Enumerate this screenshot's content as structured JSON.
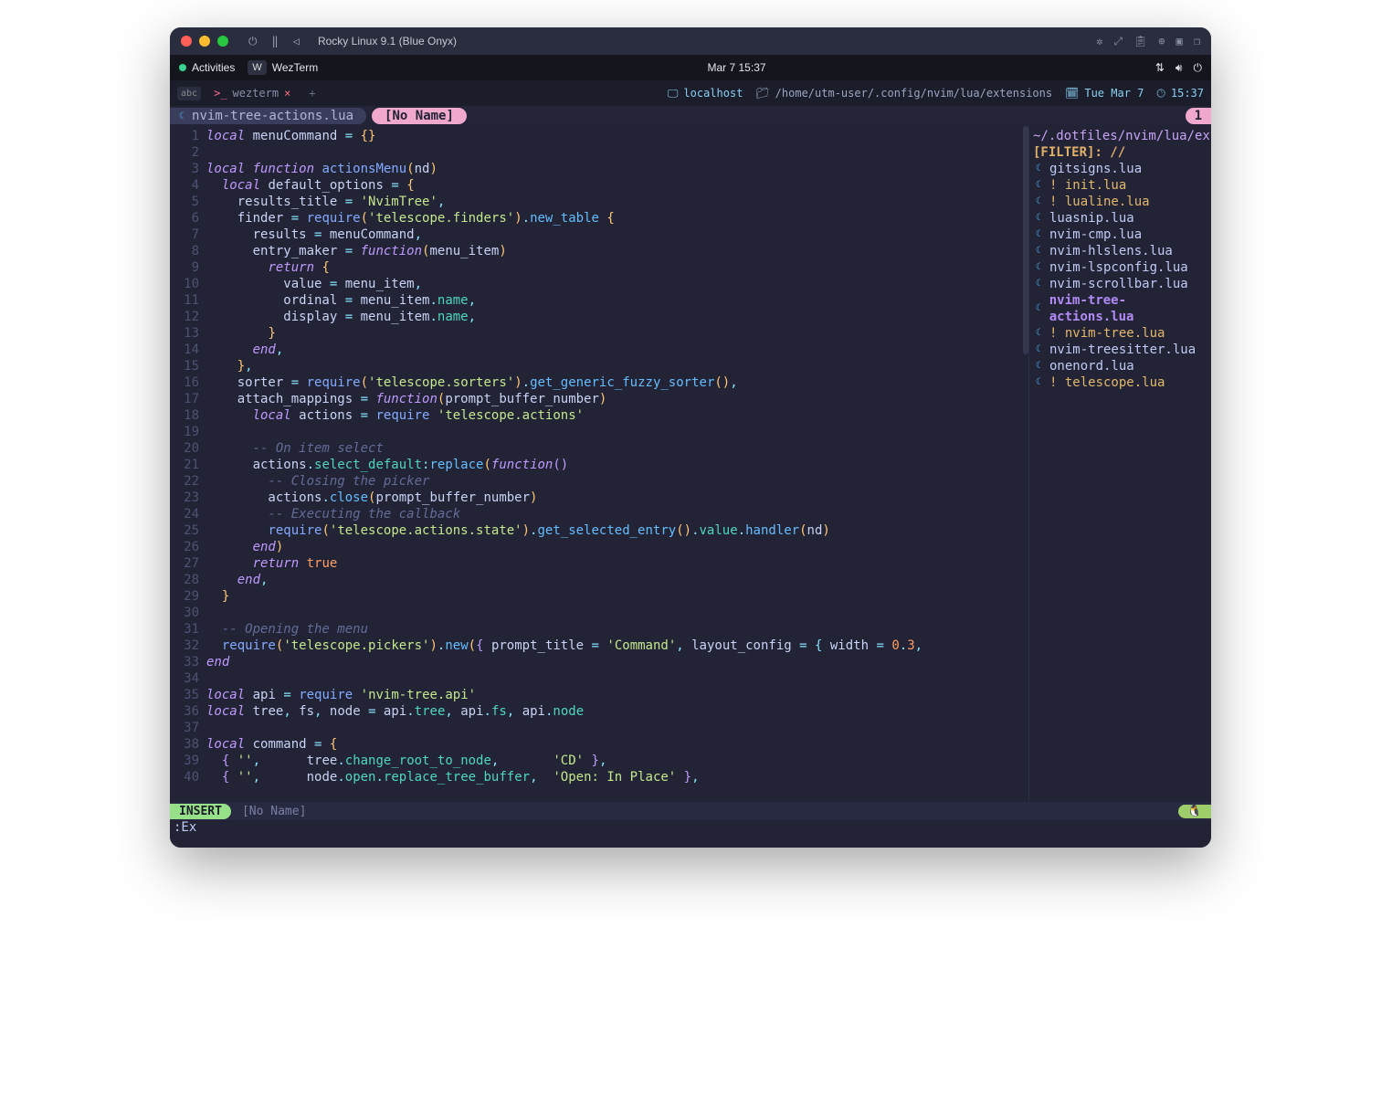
{
  "mac_titlebar": {
    "title": "Rocky Linux 9.1 (Blue Onyx)"
  },
  "gnome": {
    "activities": "Activities",
    "app_name": "WezTerm",
    "clock": "Mar 7  15:37"
  },
  "term_tabs": {
    "abc_badge": "abc",
    "tab_label": "wezterm",
    "host": "localhost",
    "path": "/home/utm-user/.config/nvim/lua/extensions",
    "date": "Tue Mar 7",
    "time": "15:37"
  },
  "bufferline": {
    "tab1": "nvim-tree-actions.lua",
    "tab2": "[No Name]",
    "count": "1"
  },
  "sidebar": {
    "path": "~/.dotfiles/nvim/lua/exte",
    "filter_label": "[FILT",
    "filter_typed": "E",
    "filter_after": "R]: //",
    "files": [
      {
        "name": "gitsigns.lua",
        "mod": false
      },
      {
        "name": "! init.lua",
        "mod": true
      },
      {
        "name": "! lualine.lua",
        "mod": true
      },
      {
        "name": "luasnip.lua",
        "mod": false
      },
      {
        "name": "nvim-cmp.lua",
        "mod": false
      },
      {
        "name": "nvim-hlslens.lua",
        "mod": false
      },
      {
        "name": "nvim-lspconfig.lua",
        "mod": false
      },
      {
        "name": "nvim-scrollbar.lua",
        "mod": false
      },
      {
        "name": "nvim-tree-actions.lua",
        "mod": false,
        "sel": true
      },
      {
        "name": "! nvim-tree.lua",
        "mod": true
      },
      {
        "name": "nvim-treesitter.lua",
        "mod": false
      },
      {
        "name": "onenord.lua",
        "mod": false
      },
      {
        "name": "! telescope.lua",
        "mod": true
      }
    ]
  },
  "statusline": {
    "mode": "INSERT",
    "filename": "[No Name]",
    "os_icon": "🐧"
  },
  "cmdline": ":Ex",
  "code_lines": [
    {
      "n": 1,
      "tokens": [
        [
          "kw",
          "local"
        ],
        [
          "id",
          " menuCommand "
        ],
        [
          "op",
          "="
        ],
        [
          "id",
          " "
        ],
        [
          "par",
          "{}"
        ]
      ]
    },
    {
      "n": 2,
      "tokens": []
    },
    {
      "n": 3,
      "tokens": [
        [
          "kw",
          "local function"
        ],
        [
          "id",
          " "
        ],
        [
          "fn",
          "actionsMenu"
        ],
        [
          "par",
          "("
        ],
        [
          "id",
          "nd"
        ],
        [
          "par",
          ")"
        ]
      ]
    },
    {
      "n": 4,
      "tokens": [
        [
          "id",
          "  "
        ],
        [
          "kw",
          "local"
        ],
        [
          "id",
          " default_options "
        ],
        [
          "op",
          "="
        ],
        [
          "id",
          " "
        ],
        [
          "par",
          "{"
        ]
      ]
    },
    {
      "n": 5,
      "tokens": [
        [
          "id",
          "    results_title "
        ],
        [
          "op",
          "="
        ],
        [
          "id",
          " "
        ],
        [
          "str",
          "'NvimTree'"
        ],
        [
          "op",
          ","
        ]
      ]
    },
    {
      "n": 6,
      "tokens": [
        [
          "id",
          "    finder "
        ],
        [
          "op",
          "="
        ],
        [
          "id",
          " "
        ],
        [
          "fn",
          "require"
        ],
        [
          "par",
          "("
        ],
        [
          "str",
          "'telescope.finders'"
        ],
        [
          "par",
          ")"
        ],
        [
          "op",
          "."
        ],
        [
          "fnb",
          "new_table"
        ],
        [
          "id",
          " "
        ],
        [
          "par",
          "{"
        ]
      ]
    },
    {
      "n": 7,
      "tokens": [
        [
          "id",
          "      results "
        ],
        [
          "op",
          "="
        ],
        [
          "id",
          " menuCommand"
        ],
        [
          "op",
          ","
        ]
      ]
    },
    {
      "n": 8,
      "tokens": [
        [
          "id",
          "      entry_maker "
        ],
        [
          "op",
          "="
        ],
        [
          "id",
          " "
        ],
        [
          "kw",
          "function"
        ],
        [
          "par",
          "("
        ],
        [
          "id",
          "menu_item"
        ],
        [
          "par",
          ")"
        ]
      ]
    },
    {
      "n": 9,
      "tokens": [
        [
          "id",
          "        "
        ],
        [
          "kw",
          "return"
        ],
        [
          "id",
          " "
        ],
        [
          "par",
          "{"
        ]
      ]
    },
    {
      "n": 10,
      "tokens": [
        [
          "id",
          "          value "
        ],
        [
          "op",
          "="
        ],
        [
          "id",
          " menu_item"
        ],
        [
          "op",
          ","
        ]
      ]
    },
    {
      "n": 11,
      "tokens": [
        [
          "id",
          "          ordinal "
        ],
        [
          "op",
          "="
        ],
        [
          "id",
          " menu_item"
        ],
        [
          "op",
          "."
        ],
        [
          "prop",
          "name"
        ],
        [
          "op",
          ","
        ]
      ]
    },
    {
      "n": 12,
      "tokens": [
        [
          "id",
          "          display "
        ],
        [
          "op",
          "="
        ],
        [
          "id",
          " menu_item"
        ],
        [
          "op",
          "."
        ],
        [
          "prop",
          "name"
        ],
        [
          "op",
          ","
        ]
      ]
    },
    {
      "n": 13,
      "tokens": [
        [
          "id",
          "        "
        ],
        [
          "par",
          "}"
        ]
      ]
    },
    {
      "n": 14,
      "tokens": [
        [
          "id",
          "      "
        ],
        [
          "kw",
          "end"
        ],
        [
          "op",
          ","
        ]
      ]
    },
    {
      "n": 15,
      "tokens": [
        [
          "id",
          "    "
        ],
        [
          "par",
          "}"
        ],
        [
          "op",
          ","
        ]
      ]
    },
    {
      "n": 16,
      "tokens": [
        [
          "id",
          "    sorter "
        ],
        [
          "op",
          "="
        ],
        [
          "id",
          " "
        ],
        [
          "fn",
          "require"
        ],
        [
          "par",
          "("
        ],
        [
          "str",
          "'telescope.sorters'"
        ],
        [
          "par",
          ")"
        ],
        [
          "op",
          "."
        ],
        [
          "fnb",
          "get_generic_fuzzy_sorter"
        ],
        [
          "par",
          "()"
        ],
        [
          "op",
          ","
        ]
      ]
    },
    {
      "n": 17,
      "tokens": [
        [
          "id",
          "    attach_mappings "
        ],
        [
          "op",
          "="
        ],
        [
          "id",
          " "
        ],
        [
          "kw",
          "function"
        ],
        [
          "par",
          "("
        ],
        [
          "id",
          "prompt_buffer_number"
        ],
        [
          "par",
          ")"
        ]
      ]
    },
    {
      "n": 18,
      "tokens": [
        [
          "id",
          "      "
        ],
        [
          "kw",
          "local"
        ],
        [
          "id",
          " actions "
        ],
        [
          "op",
          "="
        ],
        [
          "id",
          " "
        ],
        [
          "fn",
          "require"
        ],
        [
          "id",
          " "
        ],
        [
          "str",
          "'telescope.actions'"
        ]
      ]
    },
    {
      "n": 19,
      "tokens": []
    },
    {
      "n": 20,
      "tokens": [
        [
          "id",
          "      "
        ],
        [
          "comment",
          "-- On item select"
        ]
      ]
    },
    {
      "n": 21,
      "tokens": [
        [
          "id",
          "      actions"
        ],
        [
          "op",
          "."
        ],
        [
          "prop",
          "select_default"
        ],
        [
          "op",
          ":"
        ],
        [
          "fnb",
          "replace"
        ],
        [
          "par",
          "("
        ],
        [
          "kw",
          "function"
        ],
        [
          "par2",
          "()"
        ]
      ]
    },
    {
      "n": 22,
      "tokens": [
        [
          "id",
          "        "
        ],
        [
          "comment",
          "-- Closing the picker"
        ]
      ]
    },
    {
      "n": 23,
      "tokens": [
        [
          "id",
          "        actions"
        ],
        [
          "op",
          "."
        ],
        [
          "fnb",
          "close"
        ],
        [
          "par",
          "("
        ],
        [
          "id",
          "prompt_buffer_number"
        ],
        [
          "par",
          ")"
        ]
      ]
    },
    {
      "n": 24,
      "tokens": [
        [
          "id",
          "        "
        ],
        [
          "comment",
          "-- Executing the callback"
        ]
      ]
    },
    {
      "n": 25,
      "tokens": [
        [
          "id",
          "        "
        ],
        [
          "fn",
          "require"
        ],
        [
          "par",
          "("
        ],
        [
          "str",
          "'telescope.actions.state'"
        ],
        [
          "par",
          ")"
        ],
        [
          "op",
          "."
        ],
        [
          "fnb",
          "get_selected_entry"
        ],
        [
          "par",
          "()"
        ],
        [
          "op",
          "."
        ],
        [
          "prop",
          "value"
        ],
        [
          "op",
          "."
        ],
        [
          "fnb",
          "handler"
        ],
        [
          "par",
          "("
        ],
        [
          "id",
          "nd"
        ],
        [
          "par",
          ")"
        ]
      ]
    },
    {
      "n": 26,
      "tokens": [
        [
          "id",
          "      "
        ],
        [
          "kw",
          "end"
        ],
        [
          "par",
          ")"
        ]
      ]
    },
    {
      "n": 27,
      "tokens": [
        [
          "id",
          "      "
        ],
        [
          "kw",
          "return"
        ],
        [
          "id",
          " "
        ],
        [
          "bool",
          "true"
        ]
      ]
    },
    {
      "n": 28,
      "tokens": [
        [
          "id",
          "    "
        ],
        [
          "kw",
          "end"
        ],
        [
          "op",
          ","
        ]
      ]
    },
    {
      "n": 29,
      "tokens": [
        [
          "id",
          "  "
        ],
        [
          "par",
          "}"
        ]
      ]
    },
    {
      "n": 30,
      "tokens": []
    },
    {
      "n": 31,
      "tokens": [
        [
          "id",
          "  "
        ],
        [
          "comment",
          "-- Opening the menu"
        ]
      ]
    },
    {
      "n": 32,
      "tokens": [
        [
          "id",
          "  "
        ],
        [
          "fn",
          "require"
        ],
        [
          "par",
          "("
        ],
        [
          "str",
          "'telescope.pickers'"
        ],
        [
          "par",
          ")"
        ],
        [
          "op",
          "."
        ],
        [
          "fnb",
          "new"
        ],
        [
          "par",
          "("
        ],
        [
          "par2",
          "{"
        ],
        [
          "id",
          " prompt_title "
        ],
        [
          "op",
          "="
        ],
        [
          "id",
          " "
        ],
        [
          "str",
          "'Command'"
        ],
        [
          "op",
          ","
        ],
        [
          "id",
          " layout_config "
        ],
        [
          "op",
          "="
        ],
        [
          "id",
          " "
        ],
        [
          "par3",
          "{"
        ],
        [
          "id",
          " width "
        ],
        [
          "op",
          "="
        ],
        [
          "id",
          " "
        ],
        [
          "num",
          "0"
        ],
        [
          "op",
          "."
        ],
        [
          "num",
          "3"
        ],
        [
          "op",
          ","
        ]
      ]
    },
    {
      "n": 33,
      "tokens": [
        [
          "kw",
          "end"
        ]
      ]
    },
    {
      "n": 34,
      "tokens": []
    },
    {
      "n": 35,
      "tokens": [
        [
          "kw",
          "local"
        ],
        [
          "id",
          " api "
        ],
        [
          "op",
          "="
        ],
        [
          "id",
          " "
        ],
        [
          "fn",
          "require"
        ],
        [
          "id",
          " "
        ],
        [
          "str",
          "'nvim-tree.api'"
        ]
      ]
    },
    {
      "n": 36,
      "tokens": [
        [
          "kw",
          "local"
        ],
        [
          "id",
          " tree"
        ],
        [
          "op",
          ","
        ],
        [
          "id",
          " fs"
        ],
        [
          "op",
          ","
        ],
        [
          "id",
          " node "
        ],
        [
          "op",
          "="
        ],
        [
          "id",
          " api"
        ],
        [
          "op",
          "."
        ],
        [
          "prop",
          "tree"
        ],
        [
          "op",
          ","
        ],
        [
          "id",
          " api"
        ],
        [
          "op",
          "."
        ],
        [
          "prop",
          "fs"
        ],
        [
          "op",
          ","
        ],
        [
          "id",
          " api"
        ],
        [
          "op",
          "."
        ],
        [
          "prop",
          "node"
        ]
      ]
    },
    {
      "n": 37,
      "tokens": []
    },
    {
      "n": 38,
      "tokens": [
        [
          "kw",
          "local"
        ],
        [
          "id",
          " command "
        ],
        [
          "op",
          "="
        ],
        [
          "id",
          " "
        ],
        [
          "par",
          "{"
        ]
      ]
    },
    {
      "n": 39,
      "tokens": [
        [
          "id",
          "  "
        ],
        [
          "par2",
          "{"
        ],
        [
          "id",
          " "
        ],
        [
          "str",
          "''"
        ],
        [
          "op",
          ","
        ],
        [
          "id",
          "      tree"
        ],
        [
          "op",
          "."
        ],
        [
          "prop",
          "change_root_to_node"
        ],
        [
          "op",
          ","
        ],
        [
          "id",
          "       "
        ],
        [
          "str",
          "'CD'"
        ],
        [
          "id",
          " "
        ],
        [
          "par2",
          "}"
        ],
        [
          "op",
          ","
        ]
      ]
    },
    {
      "n": 40,
      "tokens": [
        [
          "id",
          "  "
        ],
        [
          "par2",
          "{"
        ],
        [
          "id",
          " "
        ],
        [
          "str",
          "''"
        ],
        [
          "op",
          ","
        ],
        [
          "id",
          "      node"
        ],
        [
          "op",
          "."
        ],
        [
          "prop",
          "open"
        ],
        [
          "op",
          "."
        ],
        [
          "prop",
          "replace_tree_buffer"
        ],
        [
          "op",
          ","
        ],
        [
          "id",
          "  "
        ],
        [
          "str",
          "'Open: In Place'"
        ],
        [
          "id",
          " "
        ],
        [
          "par2",
          "}"
        ],
        [
          "op",
          ","
        ]
      ]
    }
  ]
}
